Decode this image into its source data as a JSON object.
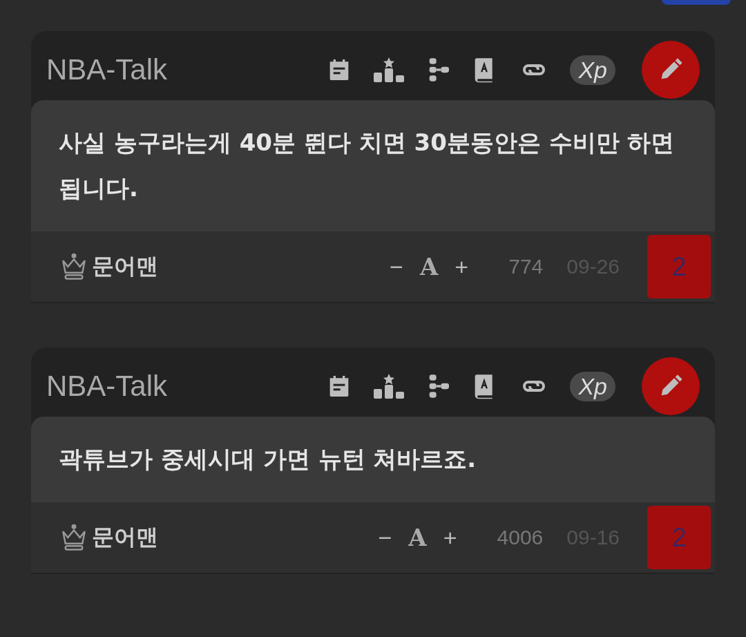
{
  "top_button": {
    "kind": "cut"
  },
  "posts": [
    {
      "board": "NBA-Talk",
      "xp": "Xp",
      "text": "사실 농구라는게 40분 뛴다 치면 30분동안은 수비만 하면 됩니다.",
      "author": "문어맨",
      "minus": "−",
      "font": "A",
      "plus": "+",
      "views": "774",
      "date": "09-26",
      "comments": "2"
    },
    {
      "board": "NBA-Talk",
      "xp": "Xp",
      "text": "곽튜브가 중세시대 가면 뉴턴 쳐바르죠.",
      "author": "문어맨",
      "minus": "−",
      "font": "A",
      "plus": "+",
      "views": "4006",
      "date": "09-16",
      "comments": "2"
    }
  ]
}
